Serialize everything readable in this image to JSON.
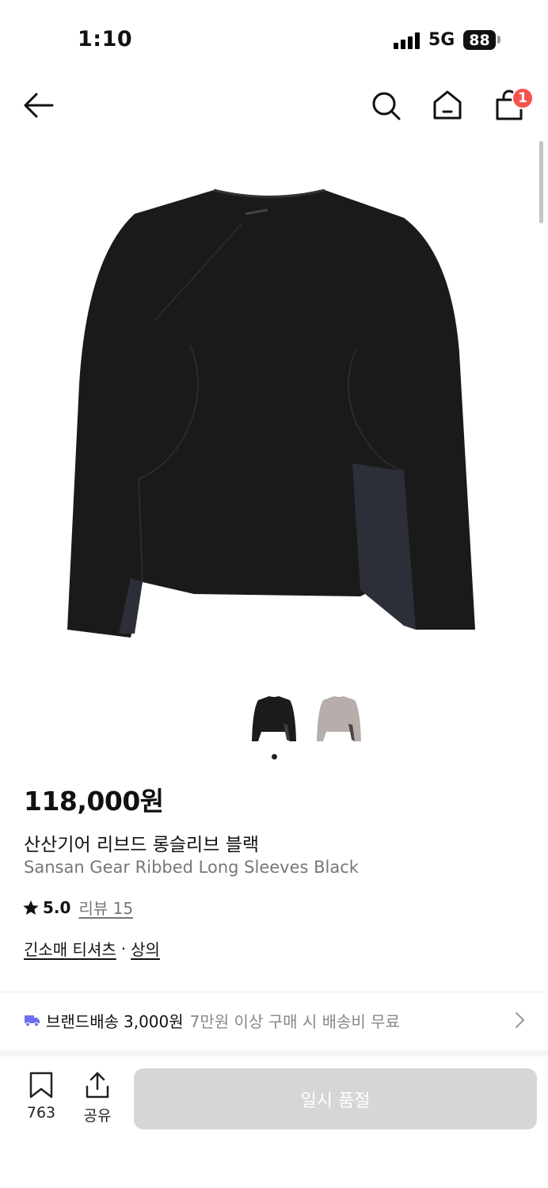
{
  "status_bar": {
    "time": "1:10",
    "network": "5G",
    "battery": "88"
  },
  "header": {
    "cart_count": "1"
  },
  "product": {
    "price": "118,000원",
    "name_ko": "산산기어 리브드 롱슬리브 블랙",
    "name_en": "Sansan Gear Ribbed Long Sleeves Black",
    "rating": "5.0",
    "review_label": "리뷰 15",
    "category_1": "긴소매 티셔츠",
    "category_sep": "·",
    "category_2": "상의",
    "thumbnails": [
      "black",
      "gray"
    ]
  },
  "shipping": {
    "brand_label": "브랜드배송",
    "fee": "3,000원",
    "note": "7만원 이상 구매 시 배송비 무료"
  },
  "bottom_bar": {
    "like_count": "763",
    "share_label": "공유",
    "buy_button": "일시 품절"
  },
  "colors": {
    "badge": "#f4524d",
    "truck": "#6e6ef0",
    "soldout_bg": "#d6d6d6"
  }
}
